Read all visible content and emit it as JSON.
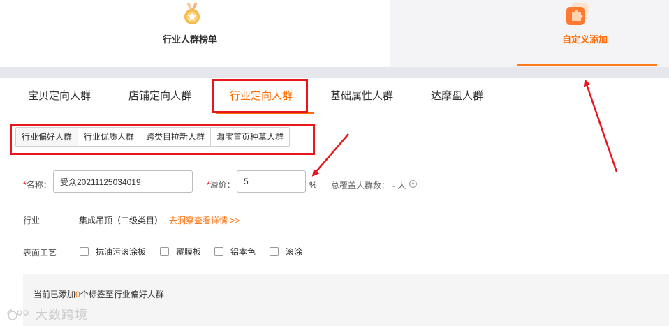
{
  "mode_tabs": {
    "ranking_label": "行业人群榜单",
    "custom_label": "自定义添加"
  },
  "category_tabs": [
    {
      "label": "宝贝定向人群"
    },
    {
      "label": "店铺定向人群"
    },
    {
      "label": "行业定向人群"
    },
    {
      "label": "基础属性人群"
    },
    {
      "label": "达摩盘人群"
    }
  ],
  "sub_tabs": [
    {
      "label": "行业偏好人群"
    },
    {
      "label": "行业优质人群"
    },
    {
      "label": "跨类目拉新人群"
    },
    {
      "label": "淘宝首页种草人群"
    }
  ],
  "form": {
    "required_mark": "*",
    "name_label": "名称：",
    "name_value": "受众20211125034019",
    "premium_label": "溢价：",
    "premium_value": "5",
    "premium_unit": "%",
    "coverage_label": "总覆盖人群数：",
    "coverage_value": "- 人",
    "industry_label": "行业",
    "industry_value": "集成吊顶（二级类目）",
    "industry_link": "去洞察查看详情 >>",
    "surface_label": "表面工艺",
    "surface_options": [
      "抗油污滚涂板",
      "覆膜板",
      "铝本色",
      "滚涂"
    ]
  },
  "info_panel": {
    "prefix": "当前已添加",
    "count": "0",
    "suffix": "个标签至行业偏好人群"
  },
  "watermark": "大数跨境",
  "colors": {
    "accent": "#ff6a00",
    "annotation_red": "#e8171e"
  }
}
